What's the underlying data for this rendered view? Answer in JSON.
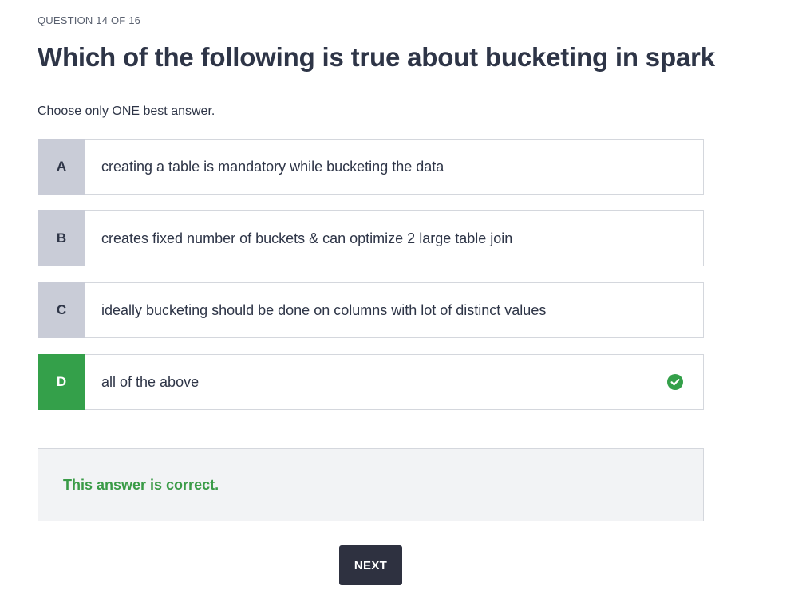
{
  "quiz": {
    "progress": "QUESTION 14 OF 16",
    "question": "Which of the following is true about bucketing in spark",
    "instructions": "Choose only ONE best answer.",
    "options": [
      {
        "letter": "A",
        "text": "creating a table is mandatory while bucketing the data",
        "selected": false,
        "correct": false
      },
      {
        "letter": "B",
        "text": "creates fixed number of buckets & can optimize 2 large table join",
        "selected": false,
        "correct": false
      },
      {
        "letter": "C",
        "text": "ideally bucketing should be done on columns with lot of distinct values",
        "selected": false,
        "correct": false
      },
      {
        "letter": "D",
        "text": "all of the above",
        "selected": true,
        "correct": true,
        "status_icon": "check-circle-icon"
      }
    ],
    "feedback": "This answer is correct.",
    "next_label": "NEXT"
  },
  "colors": {
    "correct": "#34a04a",
    "letter_bg": "#c9ccd7",
    "feedback_text": "#3a9b47",
    "button_bg": "#2e3140"
  }
}
